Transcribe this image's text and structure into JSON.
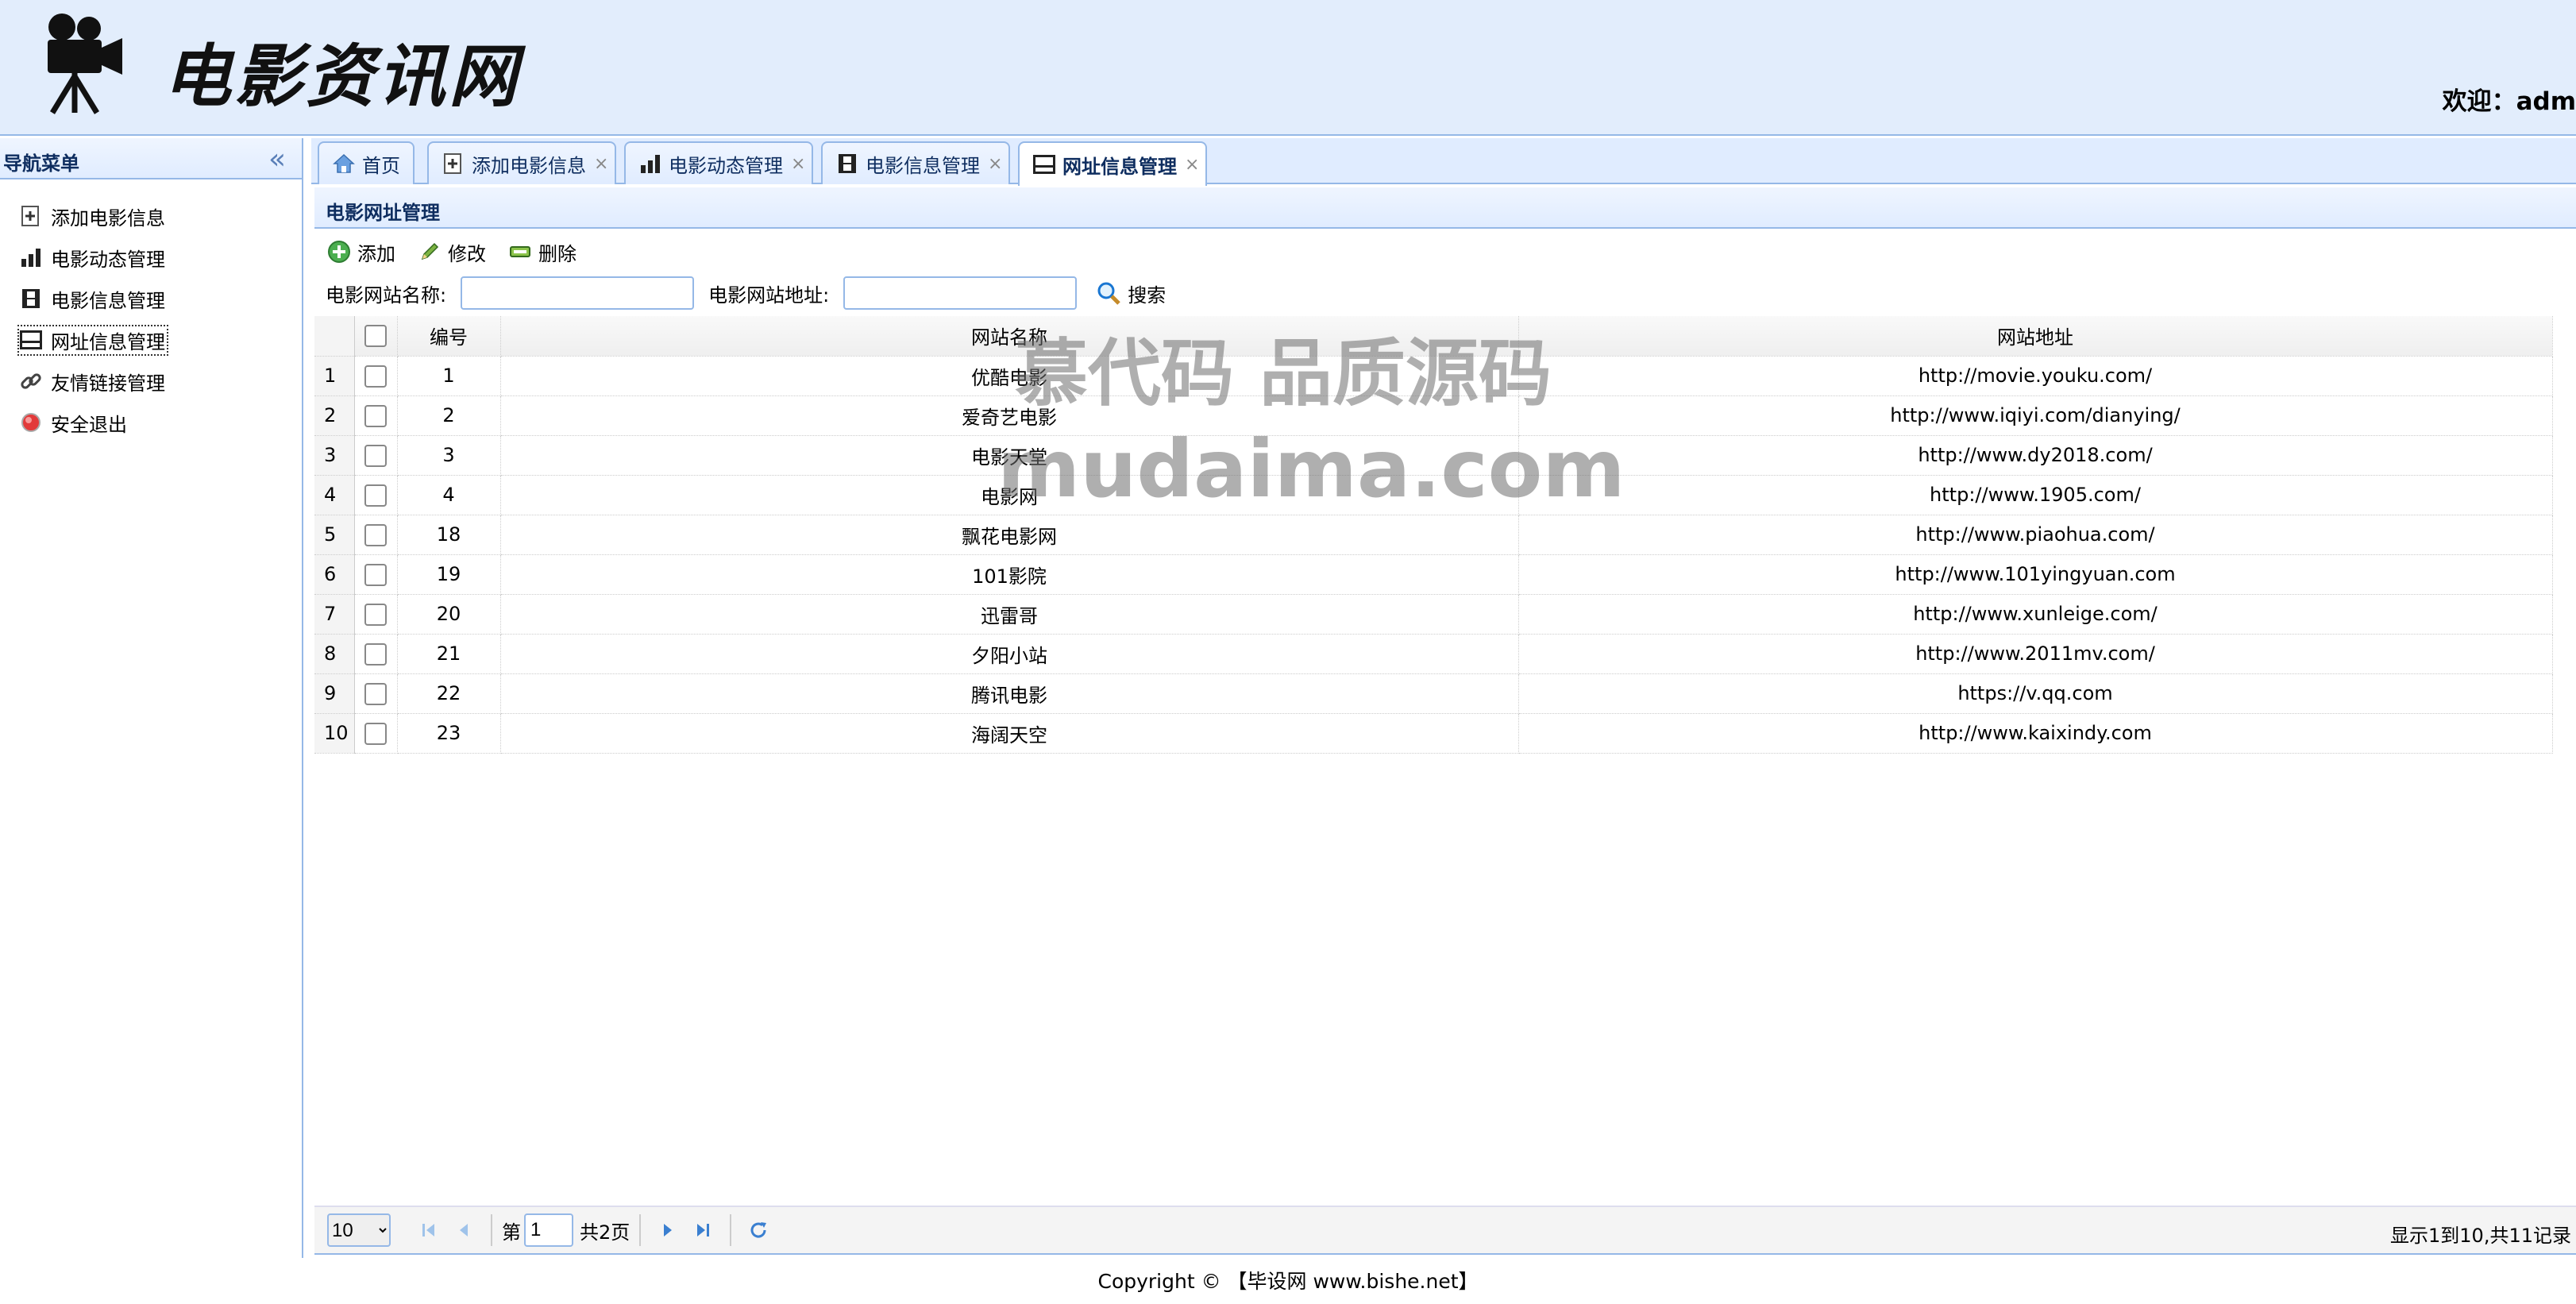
{
  "header": {
    "logo_text": "电影资讯网",
    "welcome_label": "欢迎：",
    "welcome_user": "adm"
  },
  "nav": {
    "title": "导航菜单",
    "collapse_glyph": "«",
    "items": [
      {
        "label": "添加电影信息",
        "icon": "add-doc-icon"
      },
      {
        "label": "电影动态管理",
        "icon": "bar-chart-icon"
      },
      {
        "label": "电影信息管理",
        "icon": "film-icon"
      },
      {
        "label": "网址信息管理",
        "icon": "monitor-icon"
      },
      {
        "label": "友情链接管理",
        "icon": "link-icon"
      },
      {
        "label": "安全退出",
        "icon": "exit-icon"
      }
    ]
  },
  "tabs": [
    {
      "label": "首页",
      "icon": "home-icon",
      "closable": false
    },
    {
      "label": "添加电影信息",
      "icon": "add-doc-icon",
      "closable": true
    },
    {
      "label": "电影动态管理",
      "icon": "bar-chart-icon",
      "closable": true
    },
    {
      "label": "电影信息管理",
      "icon": "film-icon",
      "closable": true
    },
    {
      "label": "网址信息管理",
      "icon": "monitor-icon",
      "closable": true,
      "active": true
    }
  ],
  "tab_close_glyph": "×",
  "panel": {
    "title": "电影网址管理"
  },
  "toolbar": {
    "add_label": "添加",
    "edit_label": "修改",
    "delete_label": "删除"
  },
  "search": {
    "name_label": "电影网站名称:",
    "name_value": "",
    "url_label": "电影网站地址:",
    "url_value": "",
    "button_label": "搜索"
  },
  "grid": {
    "columns": [
      "编号",
      "网站名称",
      "网站地址"
    ],
    "rows": [
      {
        "rn": "1",
        "id": "1",
        "name": "优酷电影",
        "url": "http://movie.youku.com/"
      },
      {
        "rn": "2",
        "id": "2",
        "name": "爱奇艺电影",
        "url": "http://www.iqiyi.com/dianying/"
      },
      {
        "rn": "3",
        "id": "3",
        "name": "电影天堂",
        "url": "http://www.dy2018.com/"
      },
      {
        "rn": "4",
        "id": "4",
        "name": "电影网",
        "url": "http://www.1905.com/"
      },
      {
        "rn": "5",
        "id": "18",
        "name": "飘花电影网",
        "url": "http://www.piaohua.com/"
      },
      {
        "rn": "6",
        "id": "19",
        "name": "101影院",
        "url": "http://www.101yingyuan.com"
      },
      {
        "rn": "7",
        "id": "20",
        "name": "迅雷哥",
        "url": "http://www.xunleige.com/"
      },
      {
        "rn": "8",
        "id": "21",
        "name": "夕阳小站",
        "url": "http://www.2011mv.com/"
      },
      {
        "rn": "9",
        "id": "22",
        "name": "腾讯电影",
        "url": "https://v.qq.com"
      },
      {
        "rn": "10",
        "id": "23",
        "name": "海阔天空",
        "url": "http://www.kaixindy.com"
      }
    ]
  },
  "pager": {
    "page_size": "10",
    "page_prefix": "第",
    "page_value": "1",
    "page_total": "共2页",
    "info": "显示1到10,共11记录"
  },
  "footer": {
    "copyright": "Copyright ©  【毕设网 www.bishe.net】"
  },
  "watermark": {
    "line1": "慕代码 品质源码",
    "line2": "mudaima.com"
  },
  "colors": {
    "header_bg": "#E2EDFC",
    "border": "#95B8E7",
    "title_text": "#0E2D5F"
  }
}
